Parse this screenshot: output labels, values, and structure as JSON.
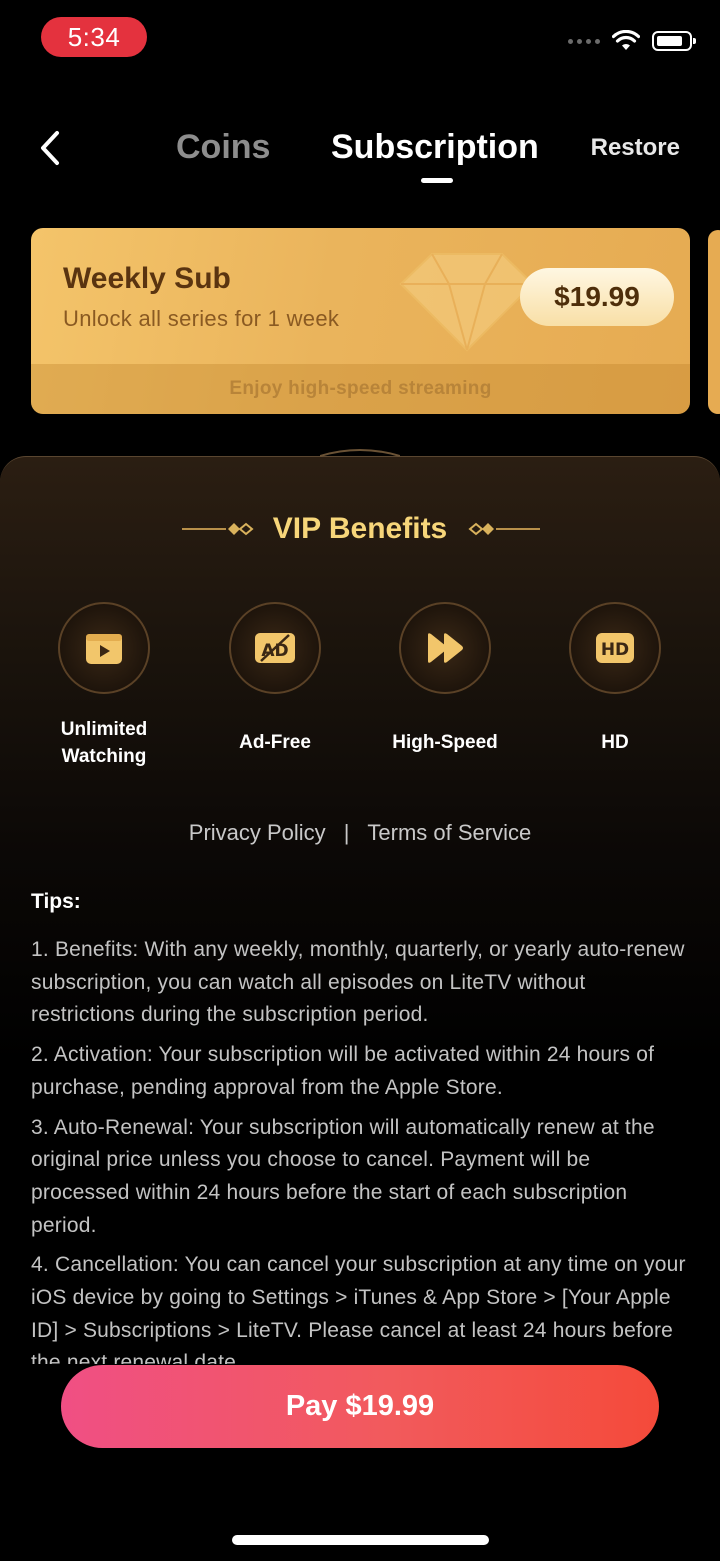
{
  "status_bar": {
    "time": "5:34"
  },
  "nav": {
    "tabs": [
      {
        "label": "Coins"
      },
      {
        "label": "Subscription"
      }
    ],
    "restore_label": "Restore"
  },
  "plan": {
    "title": "Weekly Sub",
    "description": "Unlock all series for 1 week",
    "price": "$19.99",
    "footer": "Enjoy high-speed streaming"
  },
  "vip": {
    "title": "VIP Benefits",
    "benefits": [
      {
        "label": "Unlimited Watching",
        "icon": "play-screen-icon"
      },
      {
        "label": "Ad-Free",
        "icon": "ad-free-icon"
      },
      {
        "label": "High-Speed",
        "icon": "fast-forward-icon"
      },
      {
        "label": "HD",
        "icon": "hd-icon"
      }
    ]
  },
  "links": {
    "privacy": "Privacy Policy",
    "separator": "|",
    "terms": "Terms of Service"
  },
  "tips": {
    "heading": "Tips:",
    "items": [
      "1. Benefits: With any weekly, monthly, quarterly, or yearly auto-renew subscription, you can watch all episodes on LiteTV without restrictions during the subscription period.",
      "2. Activation: Your subscription will be activated within 24 hours of purchase, pending approval from the Apple Store.",
      "3. Auto-Renewal: Your subscription will automatically renew at the original price unless you choose to cancel. Payment will be processed within 24 hours before the start of each subscription period.",
      "4. Cancellation: You can cancel your subscription at any time on your iOS device by going to Settings > iTunes & App Store > [Your Apple ID] > Subscriptions > LiteTV. Please cancel at least 24 hours before the next renewal date."
    ]
  },
  "pay_button": {
    "label": "Pay $19.99"
  },
  "colors": {
    "accent_gold": "#f7d67a",
    "pay_gradient_start": "#f04f84",
    "pay_gradient_end": "#f44a3a",
    "status_time_bg": "#e4323e"
  }
}
